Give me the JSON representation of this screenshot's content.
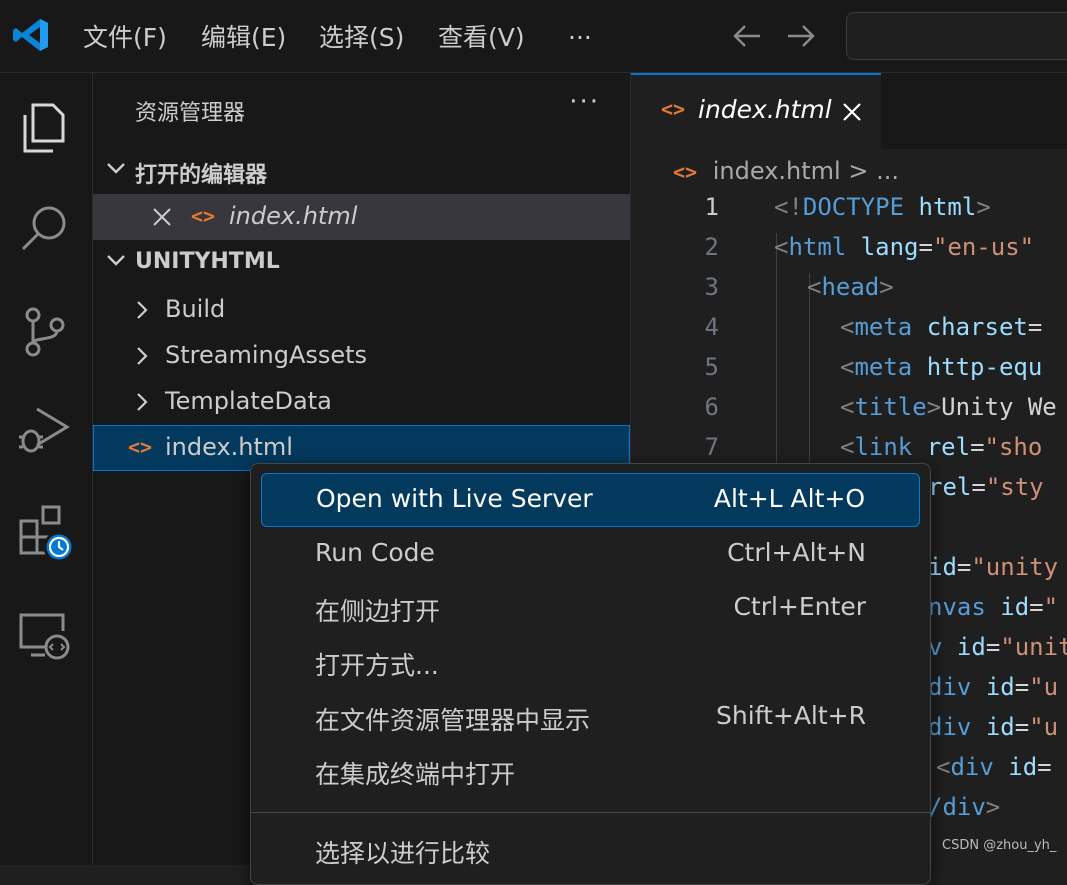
{
  "titlebar": {
    "menus": [
      "文件(F)",
      "编辑(E)",
      "选择(S)",
      "查看(V)",
      "···"
    ],
    "back_icon": "arrow-left-icon",
    "forward_icon": "arrow-right-icon"
  },
  "activity_bar": {
    "items": [
      "files-icon",
      "search-icon",
      "source-control-icon",
      "run-debug-icon",
      "extensions-icon",
      "remote-explorer-icon"
    ]
  },
  "sidebar": {
    "title": "资源管理器",
    "more": "···",
    "open_editors": {
      "header": "打开的编辑器",
      "items": [
        {
          "name": "index.html"
        }
      ]
    },
    "workspace": {
      "header": "UNITYHTML",
      "items": [
        {
          "name": "Build",
          "type": "folder"
        },
        {
          "name": "StreamingAssets",
          "type": "folder"
        },
        {
          "name": "TemplateData",
          "type": "folder"
        },
        {
          "name": "index.html",
          "type": "file"
        }
      ]
    }
  },
  "editor": {
    "tab_label": "index.html",
    "breadcrumb": {
      "file": "index.html",
      "sep": ">",
      "more": "..."
    },
    "line_numbers": [
      "1",
      "2",
      "3",
      "4",
      "5",
      "6",
      "7"
    ],
    "lines": [
      {
        "tokens": [
          [
            "pn",
            "<!"
          ],
          [
            "tg",
            "DOCTYPE"
          ],
          [
            "tx",
            " "
          ],
          [
            "at",
            "html"
          ],
          [
            "pn",
            ">"
          ]
        ]
      },
      {
        "tokens": [
          [
            "pn",
            "<"
          ],
          [
            "tg",
            "html"
          ],
          [
            "tx",
            " "
          ],
          [
            "at",
            "lang"
          ],
          [
            "tx",
            "="
          ],
          [
            "st",
            "\"en-us\""
          ]
        ]
      },
      {
        "tokens": [
          [
            "pn",
            "<"
          ],
          [
            "tg",
            "head"
          ],
          [
            "pn",
            ">"
          ]
        ]
      },
      {
        "tokens": [
          [
            "pn",
            "<"
          ],
          [
            "tg",
            "meta"
          ],
          [
            "tx",
            " "
          ],
          [
            "at",
            "charset"
          ],
          [
            "tx",
            "="
          ]
        ]
      },
      {
        "tokens": [
          [
            "pn",
            "<"
          ],
          [
            "tg",
            "meta"
          ],
          [
            "tx",
            " "
          ],
          [
            "at",
            "http-equ"
          ]
        ]
      },
      {
        "tokens": [
          [
            "pn",
            "<"
          ],
          [
            "tg",
            "title"
          ],
          [
            "pn",
            ">"
          ],
          [
            "tx",
            "Unity We"
          ]
        ]
      },
      {
        "tokens": [
          [
            "pn",
            "<"
          ],
          [
            "tg",
            "link"
          ],
          [
            "tx",
            " "
          ],
          [
            "at",
            "rel"
          ],
          [
            "tx",
            "="
          ],
          [
            "st",
            "\"sho"
          ]
        ]
      },
      {
        "tokens": [
          [
            "at",
            "rel"
          ],
          [
            "tx",
            "="
          ],
          [
            "st",
            "\"sty"
          ]
        ]
      },
      {
        "tokens": []
      },
      {
        "tokens": [
          [
            "at",
            "id"
          ],
          [
            "tx",
            "="
          ],
          [
            "st",
            "\"unity"
          ]
        ]
      },
      {
        "tokens": [
          [
            "tg",
            "nvas"
          ],
          [
            "tx",
            " "
          ],
          [
            "at",
            "id"
          ],
          [
            "tx",
            "="
          ],
          [
            "st",
            "\""
          ]
        ]
      },
      {
        "tokens": [
          [
            "tg",
            "v"
          ],
          [
            "tx",
            " "
          ],
          [
            "at",
            "id"
          ],
          [
            "tx",
            "="
          ],
          [
            "st",
            "\"unit"
          ]
        ]
      },
      {
        "tokens": [
          [
            "tg",
            "div"
          ],
          [
            "tx",
            " "
          ],
          [
            "at",
            "id"
          ],
          [
            "tx",
            "="
          ],
          [
            "st",
            "\"u"
          ]
        ]
      },
      {
        "tokens": [
          [
            "tg",
            "div"
          ],
          [
            "tx",
            " "
          ],
          [
            "at",
            "id"
          ],
          [
            "tx",
            "="
          ],
          [
            "st",
            "\"u"
          ]
        ]
      },
      {
        "tokens": [
          [
            "pn",
            "<"
          ],
          [
            "tg",
            "div"
          ],
          [
            "tx",
            " "
          ],
          [
            "at",
            "id"
          ],
          [
            "tx",
            "="
          ]
        ]
      },
      {
        "tokens": [
          [
            "tg",
            "/div"
          ],
          [
            "pn",
            ">"
          ]
        ]
      }
    ]
  },
  "context_menu": {
    "items": [
      {
        "label": "Open with Live Server",
        "shortcut": "Alt+L Alt+O",
        "highlighted": true
      },
      {
        "label": "Run Code",
        "shortcut": "Ctrl+Alt+N"
      },
      {
        "label": "在侧边打开",
        "shortcut": "Ctrl+Enter"
      },
      {
        "label": "打开方式...",
        "shortcut": ""
      },
      {
        "label": "在文件资源管理器中显示",
        "shortcut": "Shift+Alt+R"
      },
      {
        "label": "在集成终端中打开",
        "shortcut": ""
      },
      {
        "label": "选择以进行比较",
        "shortcut": ""
      }
    ]
  },
  "watermark": "CSDN @zhou_yh_",
  "colors": {
    "accent": "#0078d4",
    "html_icon": "#e37933",
    "menu_highlight": "#04395e"
  }
}
